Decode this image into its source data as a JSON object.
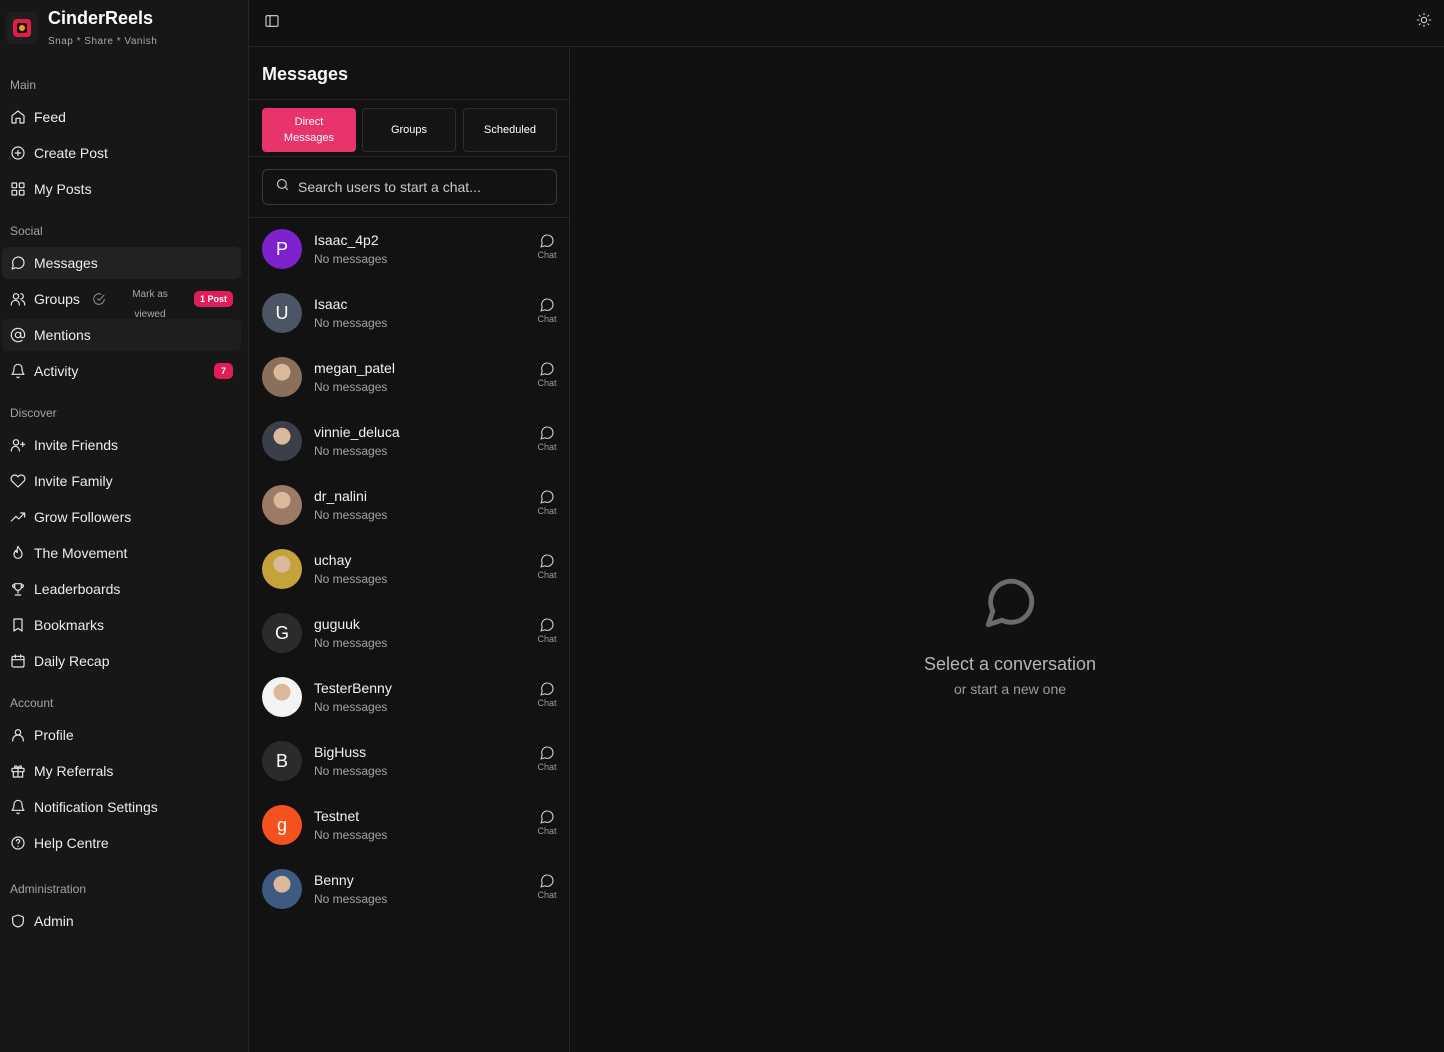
{
  "brand": {
    "name": "CinderReels",
    "tagline": "Snap * Share * Vanish"
  },
  "sidebar": {
    "sections": {
      "main": "Main",
      "social": "Social",
      "discover": "Discover",
      "account": "Account",
      "administration": "Administration"
    },
    "items": {
      "feed": "Feed",
      "create_post": "Create Post",
      "my_posts": "My Posts",
      "messages": "Messages",
      "groups": "Groups",
      "groups_mark_viewed": "Mark as viewed",
      "groups_badge": "1 Post",
      "mentions": "Mentions",
      "activity": "Activity",
      "activity_badge": "7",
      "invite_friends": "Invite Friends",
      "invite_family": "Invite Family",
      "grow_followers": "Grow Followers",
      "the_movement": "The Movement",
      "leaderboards": "Leaderboards",
      "bookmarks": "Bookmarks",
      "daily_recap": "Daily Recap",
      "profile": "Profile",
      "my_referrals": "My Referrals",
      "notification_settings": "Notification Settings",
      "help_centre": "Help Centre",
      "admin": "Admin"
    }
  },
  "messages": {
    "title": "Messages",
    "tabs": {
      "direct": "Direct Messages",
      "groups": "Groups",
      "scheduled": "Scheduled"
    },
    "search_placeholder": "Search users to start a chat...",
    "chat_label": "Chat",
    "contacts": [
      {
        "name": "Isaac_4p2",
        "sub": "No messages",
        "initial": "P",
        "color": "#7e22ce"
      },
      {
        "name": "Isaac",
        "sub": "No messages",
        "initial": "U",
        "color": "#4b5563"
      },
      {
        "name": "megan_patel",
        "sub": "No messages",
        "initial": "",
        "color": "#8a6f5a"
      },
      {
        "name": "vinnie_deluca",
        "sub": "No messages",
        "initial": "",
        "color": "#3a3f4a"
      },
      {
        "name": "dr_nalini",
        "sub": "No messages",
        "initial": "",
        "color": "#9b7a66"
      },
      {
        "name": "uchay",
        "sub": "No messages",
        "initial": "",
        "color": "#c6a23a"
      },
      {
        "name": "guguuk",
        "sub": "No messages",
        "initial": "G",
        "color": "#2b2b2b"
      },
      {
        "name": "TesterBenny",
        "sub": "No messages",
        "initial": "",
        "color": "#f4f4f4"
      },
      {
        "name": "BigHuss",
        "sub": "No messages",
        "initial": "B",
        "color": "#2b2b2b"
      },
      {
        "name": "Testnet",
        "sub": "No messages",
        "initial": "g",
        "color": "#f4511e"
      },
      {
        "name": "Benny",
        "sub": "No messages",
        "initial": "",
        "color": "#3d5a80"
      }
    ]
  },
  "empty_state": {
    "title": "Select a conversation",
    "subtitle": "or start a new one"
  }
}
